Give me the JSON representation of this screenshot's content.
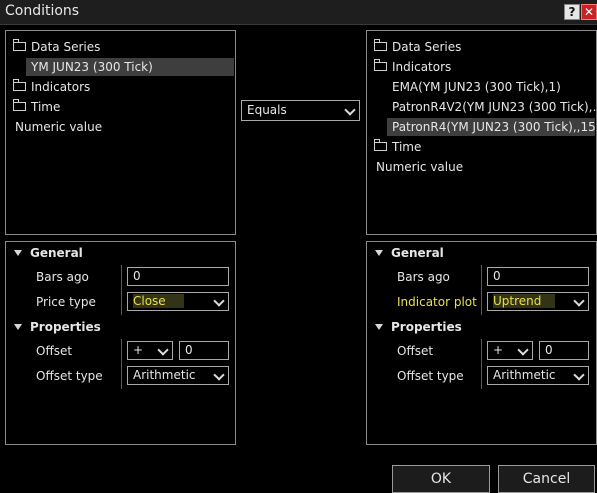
{
  "window": {
    "title": "Conditions",
    "help_label": "?",
    "close_label": "✕"
  },
  "left_tree": {
    "items": [
      {
        "label": "Data Series",
        "folder": true
      },
      {
        "label": "YM JUN23 (300 Tick)",
        "folder": false,
        "selected": true
      },
      {
        "label": "Indicators",
        "folder": true
      },
      {
        "label": "Time",
        "folder": true
      },
      {
        "label": "Numeric value",
        "folder": false
      }
    ]
  },
  "operator": {
    "value": "Equals"
  },
  "right_tree": {
    "items": [
      {
        "label": "Data Series",
        "folder": true
      },
      {
        "label": "Indicators",
        "folder": true
      },
      {
        "label": "EMA(YM JUN23 (300 Tick),1)",
        "folder": false
      },
      {
        "label": "PatronR4V2(YM JUN23 (300 Tick),…",
        "folder": false
      },
      {
        "label": "PatronR4(YM JUN23 (300 Tick),,15…",
        "folder": false,
        "selected": true
      },
      {
        "label": "Time",
        "folder": true
      },
      {
        "label": "Numeric value",
        "folder": false
      }
    ]
  },
  "left_props": {
    "general_header": "General",
    "bars_ago_label": "Bars ago",
    "bars_ago_value": "0",
    "price_type_label": "Price type",
    "price_type_value": "Close",
    "properties_header": "Properties",
    "offset_label": "Offset",
    "offset_sign": "+",
    "offset_value": "0",
    "offset_type_label": "Offset type",
    "offset_type_value": "Arithmetic"
  },
  "right_props": {
    "general_header": "General",
    "bars_ago_label": "Bars ago",
    "bars_ago_value": "0",
    "indicator_plot_label": "Indicator plot",
    "indicator_plot_value": "Uptrend",
    "properties_header": "Properties",
    "offset_label": "Offset",
    "offset_sign": "+",
    "offset_value": "0",
    "offset_type_label": "Offset type",
    "offset_type_value": "Arithmetic"
  },
  "footer": {
    "ok_label": "OK",
    "cancel_label": "Cancel"
  },
  "colors": {
    "background": "#000000",
    "highlight_text": "#e8e04a",
    "close_button": "#c92222"
  }
}
